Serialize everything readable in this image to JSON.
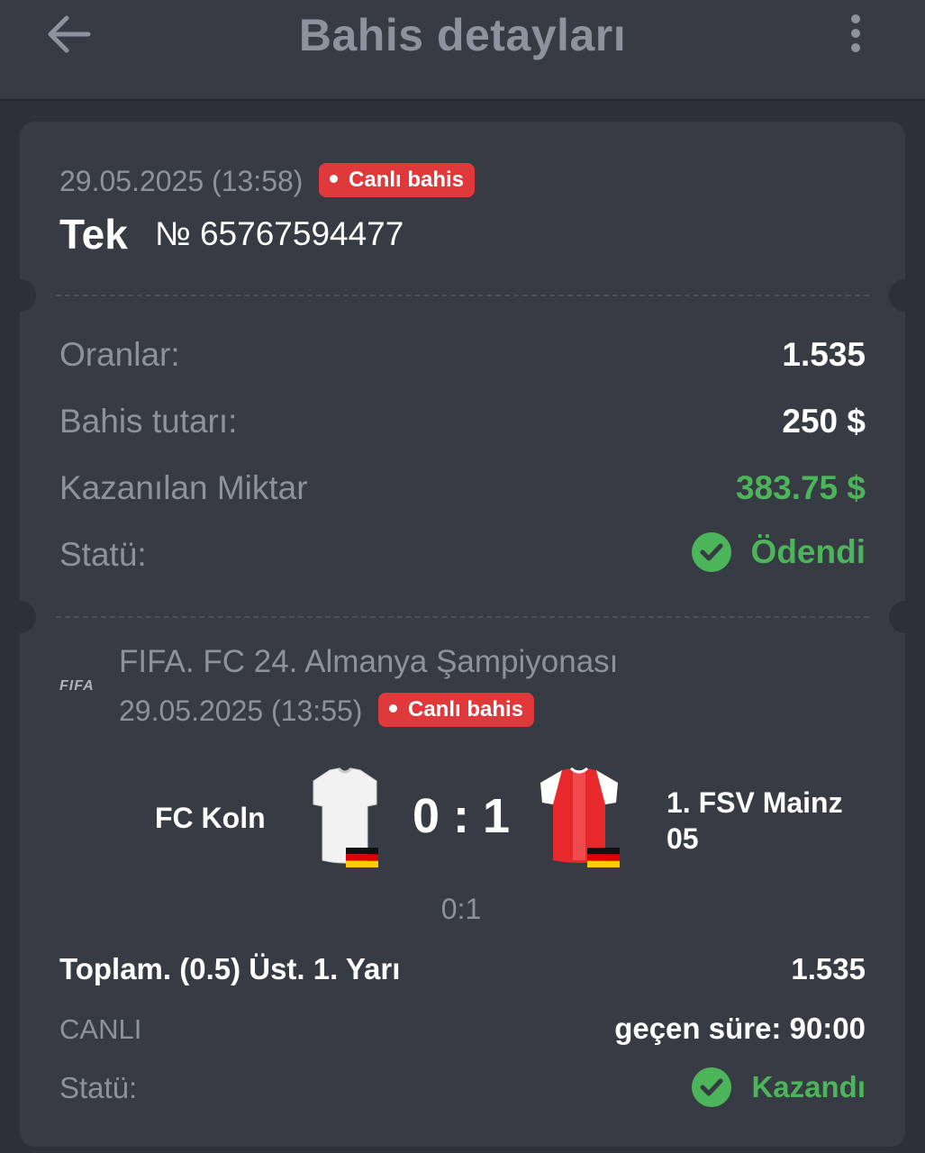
{
  "header": {
    "title": "Bahis detayları",
    "back_icon": "arrow-left-icon",
    "menu_icon": "more-vertical-icon"
  },
  "bet": {
    "date": "29.05.2025 (13:58)",
    "live_badge": "Canlı bahis",
    "type": "Tek",
    "number": "№ 65767594477",
    "rows": {
      "odds_label": "Oranlar:",
      "odds_value": "1.535",
      "stake_label": "Bahis tutarı:",
      "stake_value": "250 $",
      "win_label": "Kazanılan Miktar",
      "win_value": "383.75 $",
      "status_label": "Statü:",
      "status_value": "Ödendi"
    }
  },
  "event": {
    "logo_text": "FIFA",
    "league": "FIFA. FC 24. Almanya Şampiyonası",
    "date": "29.05.2025 (13:55)",
    "live_badge": "Canlı bahis",
    "home_team": "FC Koln",
    "away_team": "1. FSV Mainz 05",
    "score": "0 : 1",
    "half_score": "0:1",
    "market": "Toplam. (0.5) Üst. 1. Yarı",
    "market_odds": "1.535",
    "mode": "CANLI",
    "elapsed": "geçen süre: 90:00",
    "status_label": "Statü:",
    "status_value": "Kazandı"
  },
  "colors": {
    "background": "#2c3038",
    "card": "#373b43",
    "muted_text": "#8c929e",
    "accent_green": "#4cb55a",
    "badge_red": "#e0393b"
  }
}
